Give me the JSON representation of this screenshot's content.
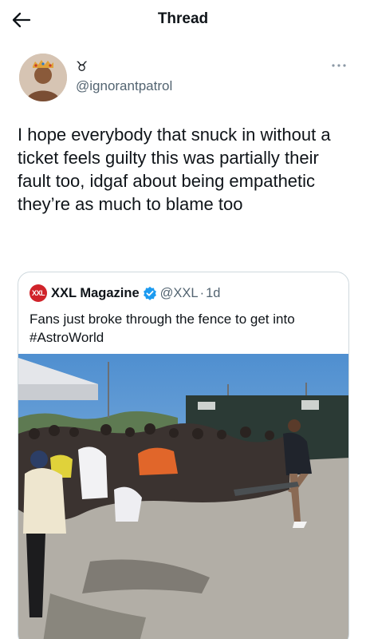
{
  "header": {
    "title": "Thread",
    "back_icon": "arrow-left-icon"
  },
  "tweet": {
    "author_name": "♉",
    "author_handle": "@ignorantpatrol",
    "text": "I hope everybody that snuck in without a ticket feels guilty this was partially their fault too, idgaf about being empathetic they’re as much to blame too",
    "more_icon": "more-horizontal-icon"
  },
  "quote": {
    "logo_text": "XXL",
    "name": "XXL Magazine",
    "verified_icon": "verified-badge-icon",
    "handle": "@XXL",
    "separator": "·",
    "time": "1d",
    "text": "Fans just broke through the fence to get into #AstroWorld",
    "media_icon": "photo-icon"
  },
  "colors": {
    "text_primary": "#0f1419",
    "text_secondary": "#536471",
    "border": "#cfd9de",
    "verified_blue": "#1d9bf0",
    "xxl_red": "#d0232a"
  }
}
